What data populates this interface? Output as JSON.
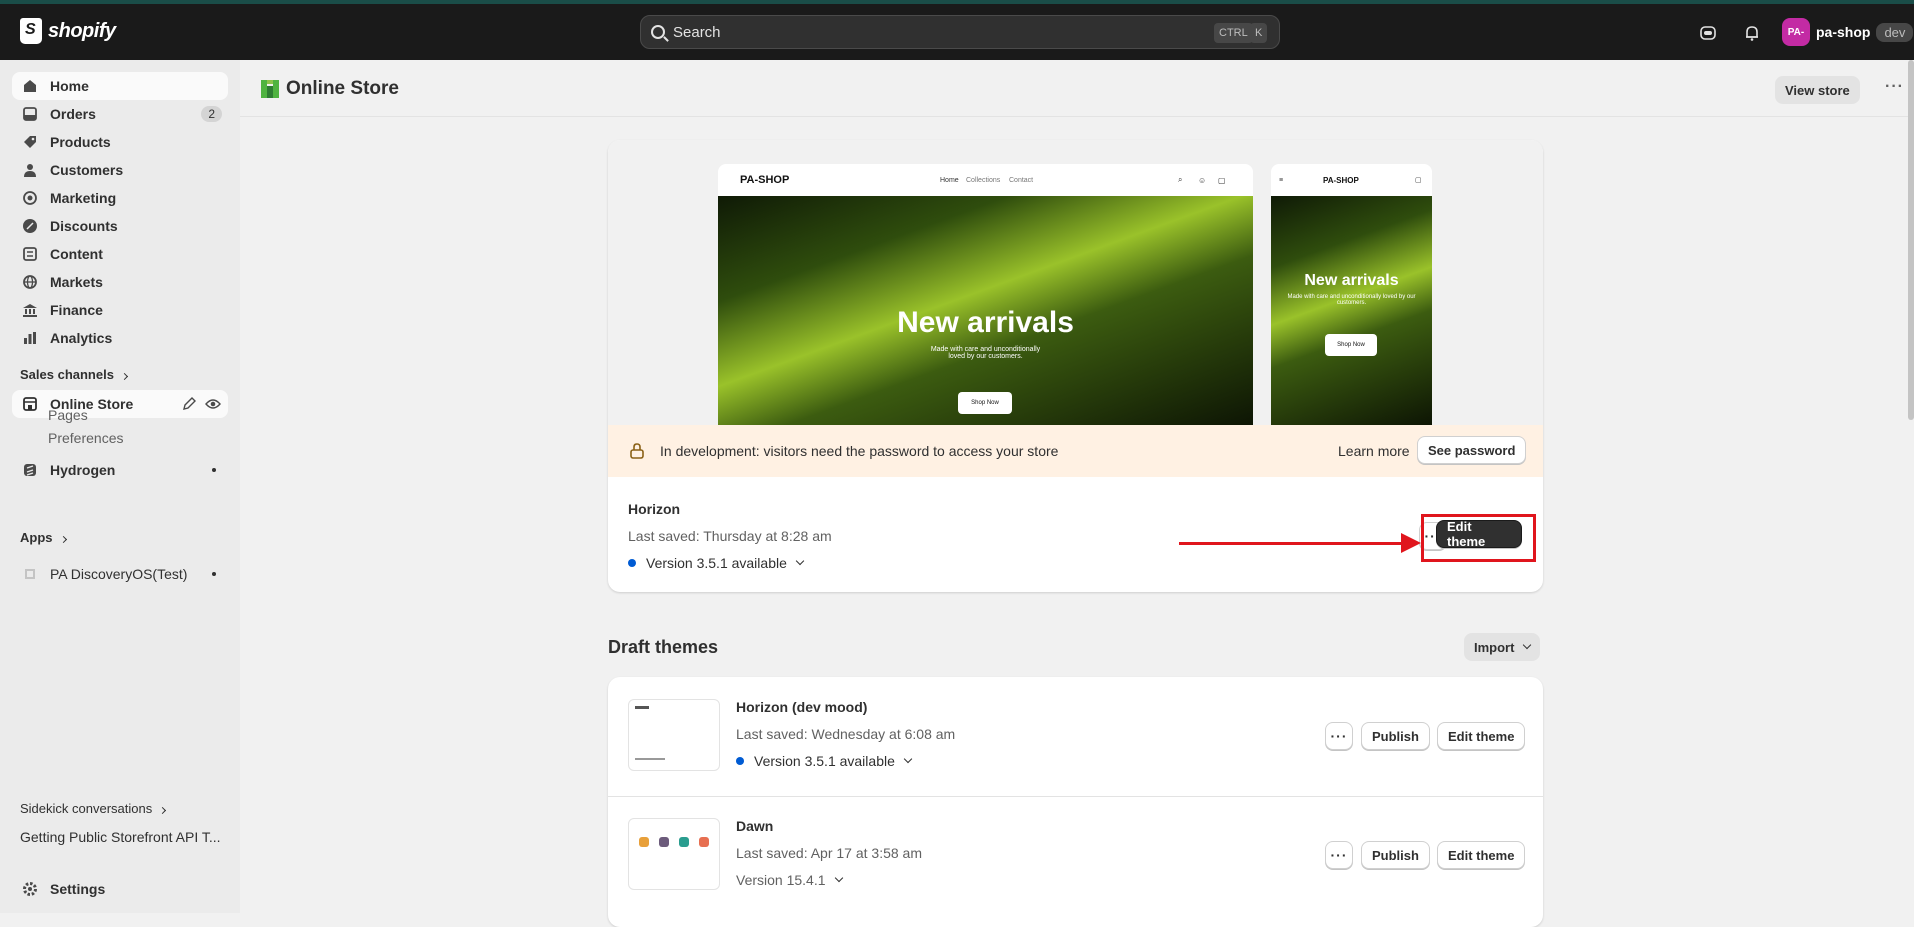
{
  "colors": {
    "topbar": "#1a1a1a",
    "accent_red": "#e0151d",
    "avatar": "#c32ba4",
    "blue_dot": "#005bd3",
    "banner": "#fff1e3"
  },
  "topbar": {
    "logo_text": "shopify",
    "search_placeholder": "Search",
    "kbd_ctrl": "CTRL",
    "kbd_k": "K",
    "avatar_initials": "PA-",
    "shop_name": "pa-shop",
    "dev_badge": "dev"
  },
  "sidebar": {
    "items": [
      {
        "label": "Home",
        "icon": "home-icon"
      },
      {
        "label": "Orders",
        "icon": "orders-icon",
        "badge": "2"
      },
      {
        "label": "Products",
        "icon": "tag-icon"
      },
      {
        "label": "Customers",
        "icon": "person-icon"
      },
      {
        "label": "Marketing",
        "icon": "target-icon"
      },
      {
        "label": "Discounts",
        "icon": "discount-icon"
      },
      {
        "label": "Content",
        "icon": "content-icon"
      },
      {
        "label": "Markets",
        "icon": "globe-icon"
      },
      {
        "label": "Finance",
        "icon": "bank-icon"
      },
      {
        "label": "Analytics",
        "icon": "chart-icon"
      }
    ],
    "sales_channels_label": "Sales channels",
    "online_store_label": "Online Store",
    "sub_pages": "Pages",
    "sub_preferences": "Preferences",
    "hydrogen_label": "Hydrogen",
    "apps_label": "Apps",
    "app_item": "PA DiscoveryOS(Test)",
    "sidekick_label": "Sidekick conversations",
    "sidekick_item": "Getting Public Storefront API T...",
    "settings_label": "Settings"
  },
  "header": {
    "title": "Online Store",
    "view_store": "View store"
  },
  "preview": {
    "store_logo": "PA-SHOP",
    "nav_home": "Home",
    "nav_collections": "Collections",
    "nav_contact": "Contact",
    "hero_title": "New arrivals",
    "hero_sub": "Made with care and unconditionally loved by our customers.",
    "hero_button": "Shop Now"
  },
  "banner": {
    "text": "In development: visitors need the password to access your store",
    "learn_more": "Learn more",
    "see_password": "See password"
  },
  "current_theme": {
    "name": "Horizon",
    "saved": "Last saved: Thursday at 8:28 am",
    "version": "Version 3.5.1 available",
    "edit_button": "Edit theme"
  },
  "drafts": {
    "heading": "Draft themes",
    "import_label": "Import",
    "themes": [
      {
        "name": "Horizon (dev mood)",
        "saved": "Last saved: Wednesday at 6:08 am",
        "version": "Version 3.5.1 available",
        "publish": "Publish",
        "edit": "Edit theme"
      },
      {
        "name": "Dawn",
        "saved": "Last saved: Apr 17 at 3:58 am",
        "version": "Version 15.4.1",
        "publish": "Publish",
        "edit": "Edit theme"
      }
    ]
  }
}
